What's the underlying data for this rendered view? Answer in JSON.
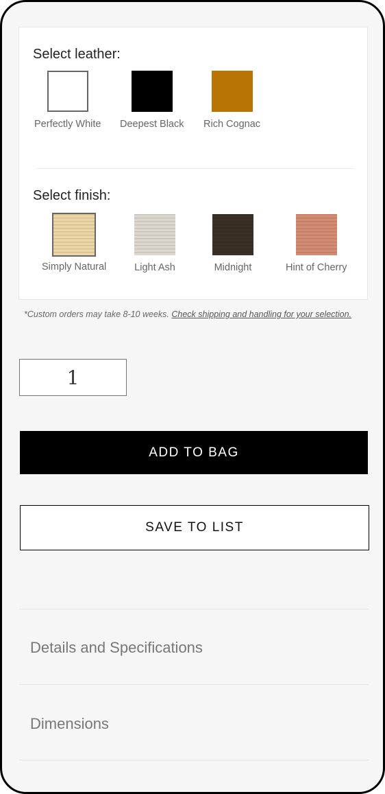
{
  "leather": {
    "title": "Select leather:",
    "options": [
      {
        "label": "Perfectly White",
        "color": "#ffffff",
        "border": "#666666"
      },
      {
        "label": "Deepest Black",
        "color": "#000000"
      },
      {
        "label": "Rich Cognac",
        "color": "#b87503"
      }
    ]
  },
  "finish": {
    "title": "Select finish:",
    "options": [
      {
        "label": "Simply Natural",
        "color": "#ecd6a5",
        "selected": true
      },
      {
        "label": "Light Ash",
        "color": "#ddd8cf"
      },
      {
        "label": "Midnight",
        "color": "#3a3026"
      },
      {
        "label": "Hint of Cherry",
        "color": "#d38b72"
      }
    ]
  },
  "note": {
    "text": "*Custom orders may take 8-10 weeks.",
    "link": "Check shipping and handling for your selection."
  },
  "quantity": {
    "value": "1"
  },
  "actions": {
    "add_to_bag": "ADD TO BAG",
    "save_to_list": "SAVE TO LIST"
  },
  "accordion": [
    "Details and Specifications",
    "Dimensions"
  ]
}
